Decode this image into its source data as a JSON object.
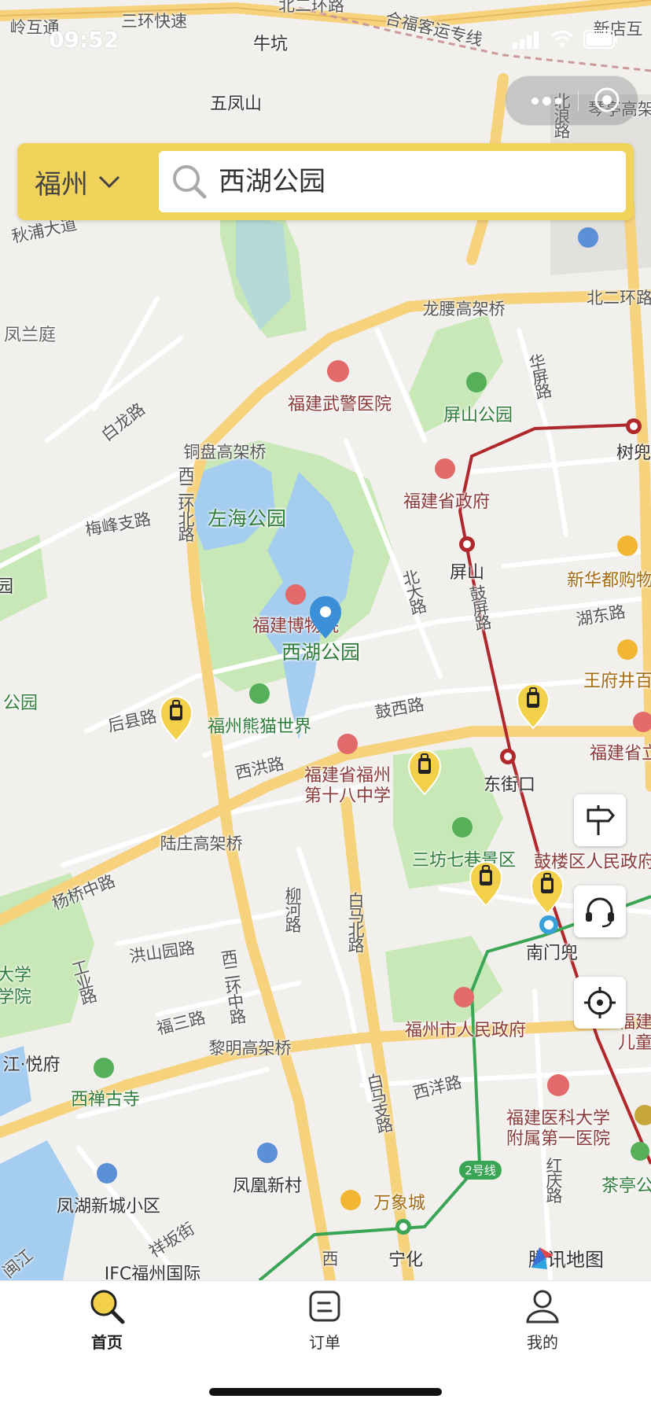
{
  "status_bar": {
    "time": "09:52"
  },
  "capsule": {
    "more_icon": "more-dots-icon",
    "close_icon": "target-icon"
  },
  "search": {
    "city": "福州",
    "query": "西湖公园"
  },
  "map": {
    "place_labels": [
      {
        "text": "三环快速",
        "kind": "road"
      },
      {
        "text": "北二环路",
        "kind": "road"
      },
      {
        "text": "合福客运专线",
        "kind": "road"
      },
      {
        "text": "新店互",
        "kind": "road"
      },
      {
        "text": "岭互通",
        "kind": "road"
      },
      {
        "text": "牛坑",
        "kind": "plain"
      },
      {
        "text": "五凤山",
        "kind": "plain"
      },
      {
        "text": "琴亭高架",
        "kind": "road"
      },
      {
        "text": "秋浦大道",
        "kind": "road"
      },
      {
        "text": "凤兰庭",
        "kind": "plain"
      },
      {
        "text": "龙腰高架桥",
        "kind": "road"
      },
      {
        "text": "北二环路",
        "kind": "road"
      },
      {
        "text": "福建武警医院",
        "kind": "poi-red"
      },
      {
        "text": "屏山公园",
        "kind": "poi-green"
      },
      {
        "text": "白龙路",
        "kind": "road"
      },
      {
        "text": "铜盘高架桥",
        "kind": "road"
      },
      {
        "text": "福建省政府",
        "kind": "poi-red"
      },
      {
        "text": "树兜",
        "kind": "plain"
      },
      {
        "text": "左海公园",
        "kind": "big-green"
      },
      {
        "text": "梅峰支路",
        "kind": "road"
      },
      {
        "text": "屏山",
        "kind": "plain"
      },
      {
        "text": "新华都购物",
        "kind": "poi-orange"
      },
      {
        "text": "湖东路",
        "kind": "road"
      },
      {
        "text": "福建博物院",
        "kind": "poi-red"
      },
      {
        "text": "西湖公园",
        "kind": "big-green"
      },
      {
        "text": "王府井百",
        "kind": "poi-orange"
      },
      {
        "text": "后县路",
        "kind": "road"
      },
      {
        "text": "福州熊猫世界",
        "kind": "poi-green"
      },
      {
        "text": "鼓西路",
        "kind": "road"
      },
      {
        "text": "福建省立",
        "kind": "poi-red"
      },
      {
        "text": "西洪路",
        "kind": "road"
      },
      {
        "text": "福建省福州",
        "kind": "poi-red"
      },
      {
        "text": "第十八中学",
        "kind": "poi-red"
      },
      {
        "text": "东街口",
        "kind": "plain"
      },
      {
        "text": "陆庄高架桥",
        "kind": "road"
      },
      {
        "text": "三坊七巷景区",
        "kind": "poi-green"
      },
      {
        "text": "鼓楼区人民政府",
        "kind": "poi-red"
      },
      {
        "text": "杨桥中路",
        "kind": "road"
      },
      {
        "text": "南门兜",
        "kind": "plain"
      },
      {
        "text": "洪山园路",
        "kind": "road"
      },
      {
        "text": "大学",
        "kind": "poi-green"
      },
      {
        "text": "学院",
        "kind": "poi-green"
      },
      {
        "text": "福三路",
        "kind": "road"
      },
      {
        "text": "福州市人民政府",
        "kind": "poi-red"
      },
      {
        "text": "福建",
        "kind": "poi-red"
      },
      {
        "text": "儿童",
        "kind": "poi-red"
      },
      {
        "text": "江·悦府",
        "kind": "plain"
      },
      {
        "text": "黎明高架桥",
        "kind": "road"
      },
      {
        "text": "西禅古寺",
        "kind": "poi-green"
      },
      {
        "text": "西洋路",
        "kind": "road"
      },
      {
        "text": "福建医科大学",
        "kind": "poi-red"
      },
      {
        "text": "附属第一医院",
        "kind": "poi-red"
      },
      {
        "text": "2号线",
        "kind": "metro"
      },
      {
        "text": "茶亭公",
        "kind": "poi-green"
      },
      {
        "text": "凤凰新村",
        "kind": "plain"
      },
      {
        "text": "凤湖新城小区",
        "kind": "plain"
      },
      {
        "text": "万象城",
        "kind": "poi-orange"
      },
      {
        "text": "祥坂街",
        "kind": "road"
      },
      {
        "text": "宁化",
        "kind": "plain"
      },
      {
        "text": "IFC福州国际",
        "kind": "plain"
      },
      {
        "text": "闽江",
        "kind": "road"
      },
      {
        "text": "西",
        "kind": "road"
      },
      {
        "text": "公园",
        "kind": "poi-green"
      },
      {
        "text": "园",
        "kind": "plain"
      }
    ],
    "vertical_labels": [
      {
        "text": "北浪路",
        "kind": "road"
      },
      {
        "text": "华屏路",
        "kind": "road"
      },
      {
        "text": "西二环北路",
        "kind": "road"
      },
      {
        "text": "北大路",
        "kind": "road"
      },
      {
        "text": "鼓屏路",
        "kind": "road"
      },
      {
        "text": "柳河路",
        "kind": "road"
      },
      {
        "text": "白马北路",
        "kind": "road"
      },
      {
        "text": "工业路",
        "kind": "road"
      },
      {
        "text": "西二环中路",
        "kind": "road"
      },
      {
        "text": "白马支路",
        "kind": "road"
      },
      {
        "text": "红庆路",
        "kind": "road"
      }
    ],
    "watermark": "腾讯地图",
    "markers": [
      "luggage-marker",
      "luggage-marker",
      "luggage-marker",
      "luggage-marker",
      "luggage-marker"
    ],
    "selected_pin": "location-pin-icon"
  },
  "side_buttons": [
    "signpost-icon",
    "headset-icon",
    "locate-icon"
  ],
  "tabs": [
    {
      "label": "首页",
      "icon": "search-icon",
      "active": true
    },
    {
      "label": "订单",
      "icon": "order-icon",
      "active": false
    },
    {
      "label": "我的",
      "icon": "user-icon",
      "active": false
    }
  ],
  "colors": {
    "accent": "#efd35a",
    "metro_red": "#b0282c",
    "metro_green": "#3aa655",
    "road_major": "#f7d27d",
    "park_green": "#c8e8b8",
    "water": "#a5cdf0"
  }
}
